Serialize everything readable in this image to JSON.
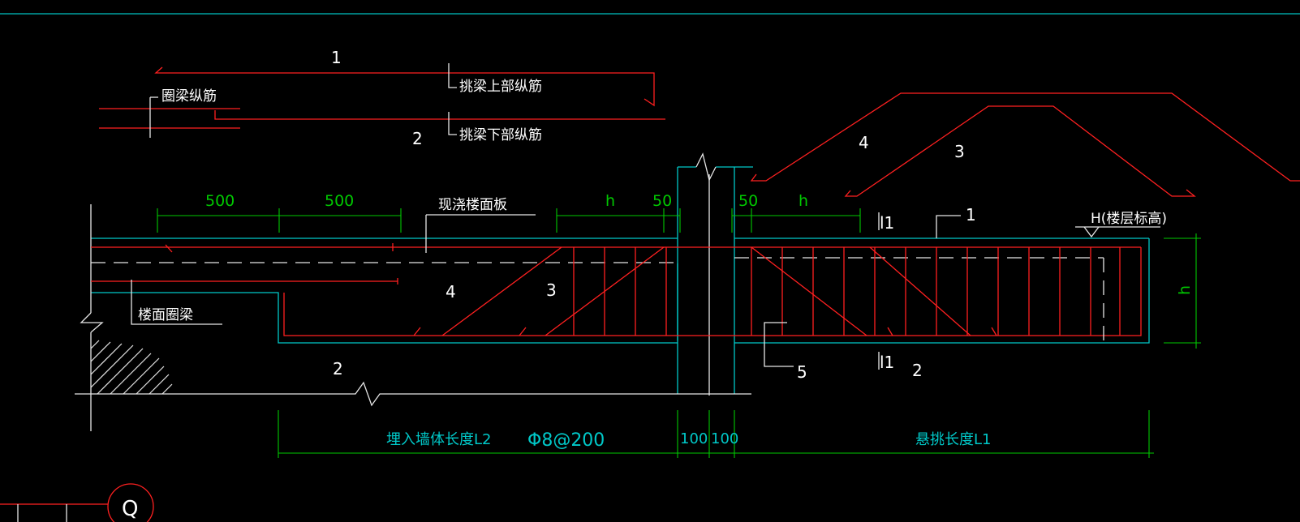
{
  "labels": {
    "ring_beam_long_bar": "圈梁纵筋",
    "cantilever_top_bar": "挑梁上部纵筋",
    "cantilever_bottom_bar": "挑梁下部纵筋",
    "cast_slab": "现浇楼面板",
    "floor_ring_beam": "楼面圈梁",
    "floor_elevation": "H(楼层标高)",
    "wall_embed_length": "埋入墙体长度L2",
    "stirrup_spec": "Φ8@200",
    "cantilever_length": "悬挑长度L1",
    "axis_q": "Q"
  },
  "numbers": {
    "n1_top": "1",
    "n2_top": "2",
    "n4_bent": "4",
    "n3_bent": "3",
    "n4_beam": "4",
    "n3_beam": "3",
    "n2_bottom": "2",
    "n1_right": "1",
    "n5": "5",
    "n2_right": "2",
    "sec_top": "l1",
    "sec_bottom": "l1"
  },
  "dims": {
    "d500a": "500",
    "d500b": "500",
    "dh_left": "h",
    "d50_left": "50",
    "d50_right": "50",
    "dh_right": "h",
    "dh_side": "h",
    "d100a": "100",
    "d100b": "100"
  },
  "colors": {
    "rebar": "#ff2020",
    "concrete_outline": "#00c8c8",
    "dimension": "#00c800",
    "annotation": "#ffffff"
  }
}
